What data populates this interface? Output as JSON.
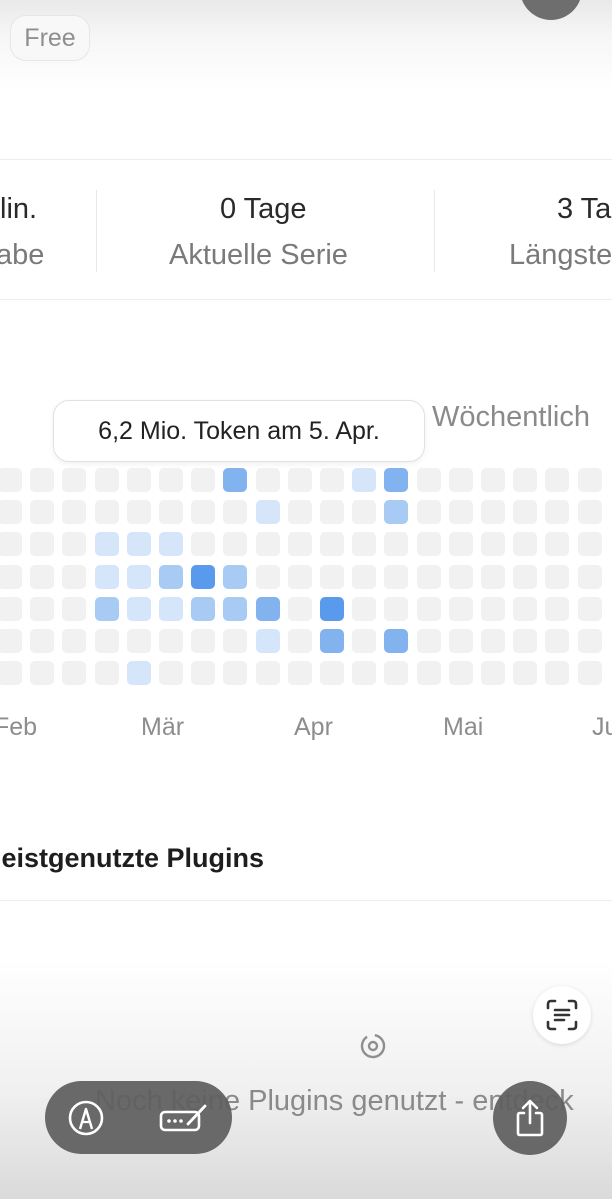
{
  "plan_badge": "Free",
  "stats": [
    {
      "value": "lin.",
      "label": "abe"
    },
    {
      "value": "0 Tage",
      "label": "Aktuelle Serie"
    },
    {
      "value": "3 Ta",
      "label": "Längste"
    }
  ],
  "tooltip": "6,2 Mio. Token am 5. Apr.",
  "period_toggle": "Wöchentlich",
  "months": [
    "Feb",
    "Mär",
    "Apr",
    "Mai",
    "Ju"
  ],
  "heatmap": {
    "colors": [
      "#f1f1f1",
      "#d5e5fa",
      "#a8cbf4",
      "#82b3ef",
      "#5a9aec"
    ],
    "levels": [
      [
        0,
        0,
        0,
        0,
        0,
        0,
        0,
        3,
        0,
        0,
        0,
        1,
        3,
        0,
        0,
        0,
        0,
        0,
        0
      ],
      [
        0,
        0,
        0,
        0,
        0,
        0,
        0,
        0,
        1,
        0,
        0,
        0,
        2,
        0,
        0,
        0,
        0,
        0,
        0
      ],
      [
        0,
        0,
        0,
        1,
        1,
        1,
        0,
        0,
        0,
        0,
        0,
        0,
        0,
        0,
        0,
        0,
        0,
        0,
        0
      ],
      [
        0,
        0,
        0,
        1,
        1,
        2,
        4,
        2,
        0,
        0,
        0,
        0,
        0,
        0,
        0,
        0,
        0,
        0,
        0
      ],
      [
        0,
        0,
        0,
        2,
        1,
        1,
        2,
        2,
        3,
        0,
        4,
        0,
        0,
        0,
        0,
        0,
        0,
        0,
        0
      ],
      [
        0,
        0,
        0,
        0,
        0,
        0,
        0,
        0,
        1,
        0,
        3,
        0,
        3,
        0,
        0,
        0,
        0,
        0,
        0
      ],
      [
        0,
        0,
        0,
        0,
        1,
        0,
        0,
        0,
        0,
        0,
        0,
        0,
        0,
        0,
        0,
        0,
        0,
        0,
        0
      ]
    ]
  },
  "plugins": {
    "title": "leistgenutzte Plugins",
    "empty_text": "Noch keine Plugins genutzt - entdeck"
  }
}
